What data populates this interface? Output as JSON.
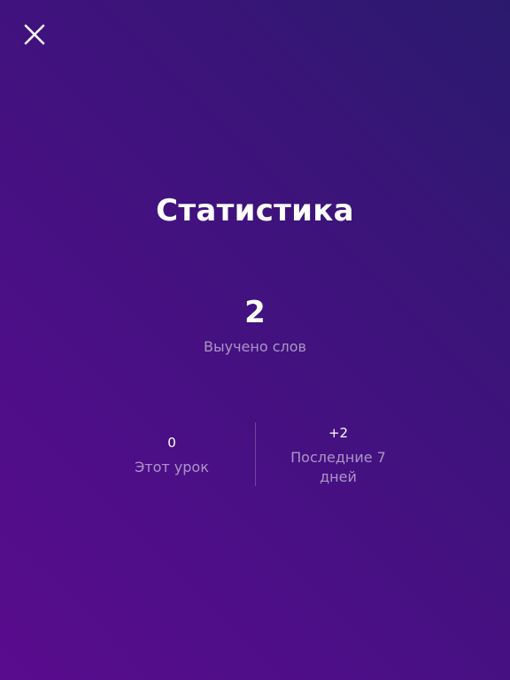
{
  "header": {
    "close_icon": "close-icon"
  },
  "title": "Статистика",
  "learned": {
    "value": "2",
    "label": "Выучено слов"
  },
  "stats": {
    "this_lesson": {
      "value": "0",
      "label": "Этот урок"
    },
    "last_7_days": {
      "value": "+2",
      "label": "Последние 7 дней"
    }
  },
  "colors": {
    "background_start": "#5a0c8e",
    "background_end": "#2a1a6e",
    "text": "#ffffff"
  }
}
